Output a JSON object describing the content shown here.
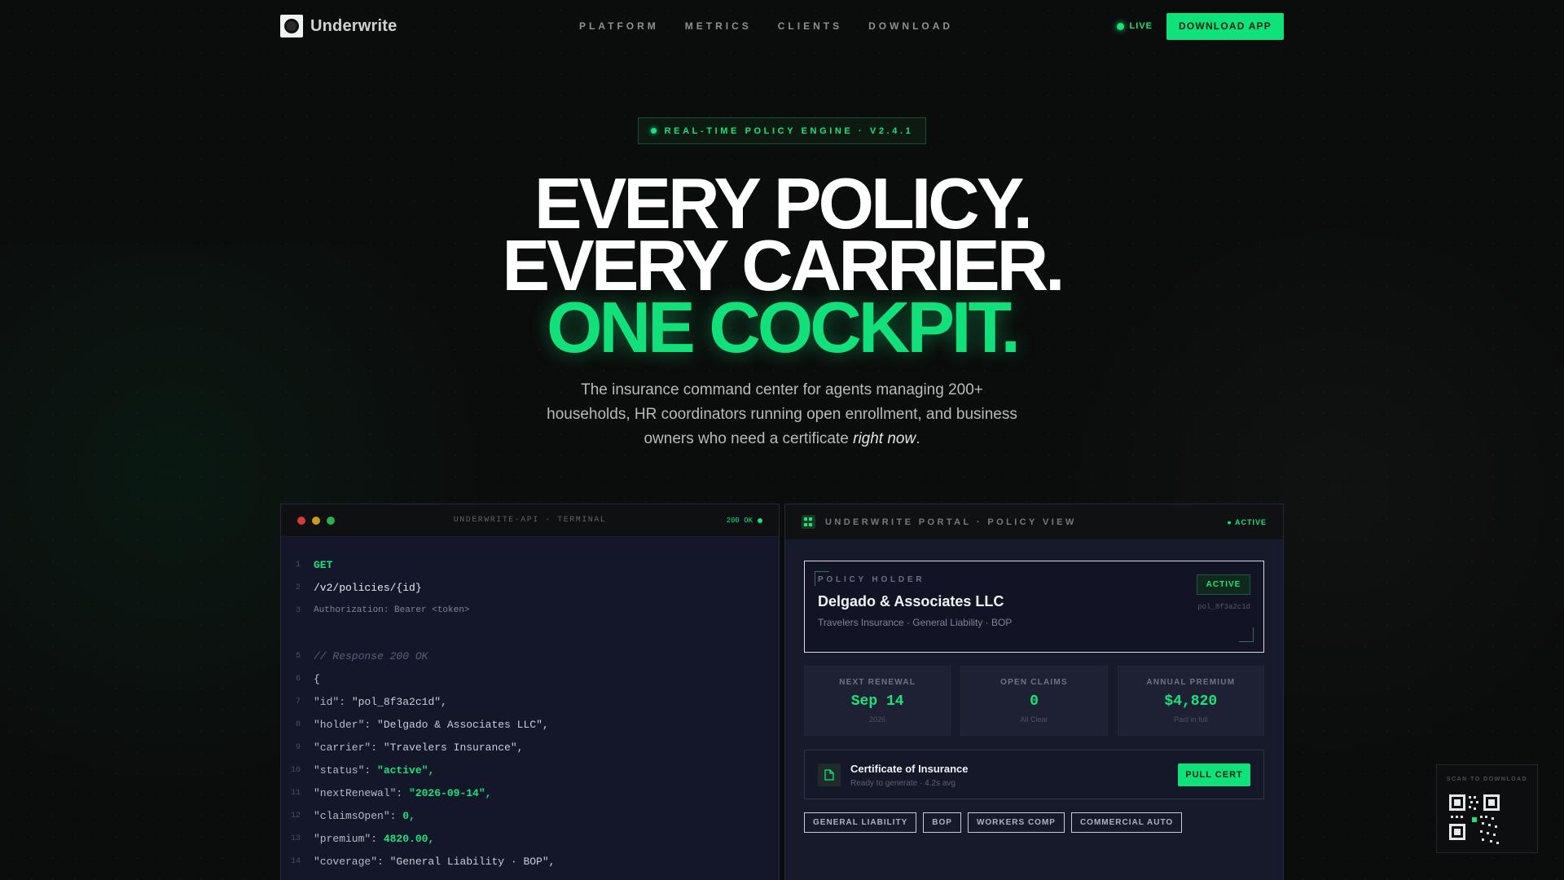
{
  "brand": {
    "name": "Underwrite"
  },
  "nav": {
    "links": [
      "PLATFORM",
      "METRICS",
      "CLIENTS",
      "DOWNLOAD"
    ],
    "live_label": "LIVE",
    "download_label": "DOWNLOAD APP"
  },
  "hero": {
    "badge": "REAL-TIME POLICY ENGINE · V2.4.1",
    "line1": "EVERY POLICY.",
    "line2": "EVERY CARRIER.",
    "line3": "ONE COCKPIT.",
    "subtitle_lead": "The insurance command center for agents managing 200+ households, HR coordinators running open enrollment, and business owners who need a certificate ",
    "subtitle_emphasis": "right now",
    "subtitle_end": "."
  },
  "terminal": {
    "title": "UNDERWRITE-API · TERMINAL",
    "status": "200 OK",
    "lines": [
      {
        "n": "1",
        "text": "GET",
        "style": "kw"
      },
      {
        "n": "2",
        "text": "/v2/policies/{id}",
        "style": "path"
      },
      {
        "n": "3",
        "text": "Authorization: Bearer <token>",
        "style": "small"
      },
      {
        "n": "",
        "text": "",
        "style": ""
      },
      {
        "n": "5",
        "text": "// Response 200 OK",
        "style": "comment"
      },
      {
        "n": "6",
        "text": "{",
        "style": ""
      },
      {
        "n": "7",
        "key": "\"id\"",
        "val": "\"pol_8f3a2c1d\",",
        "vstyle": "s"
      },
      {
        "n": "8",
        "key": "\"holder\"",
        "val": "\"Delgado & Associates LLC\",",
        "vstyle": "s"
      },
      {
        "n": "9",
        "key": "\"carrier\"",
        "val": "\"Travelers Insurance\",",
        "vstyle": "s"
      },
      {
        "n": "10",
        "key": "\"status\"",
        "val": "\"active\",",
        "vstyle": "g"
      },
      {
        "n": "11",
        "key": "\"nextRenewal\"",
        "val": "\"2026-09-14\",",
        "vstyle": "g"
      },
      {
        "n": "12",
        "key": "\"claimsOpen\"",
        "val": "0,",
        "vstyle": "g"
      },
      {
        "n": "13",
        "key": "\"premium\"",
        "val": "4820.00,",
        "vstyle": "g"
      },
      {
        "n": "14",
        "key": "\"coverage\"",
        "val": "\"General Liability · BOP\",",
        "vstyle": "s"
      }
    ]
  },
  "portal": {
    "title": "UNDERWRITE PORTAL · POLICY VIEW",
    "active_label": "● ACTIVE",
    "holder": {
      "label": "POLICY HOLDER",
      "name": "Delgado & Associates LLC",
      "meta": "Travelers Insurance · General Liability · BOP",
      "badge": "ACTIVE",
      "id": "pol_8f3a2c1d"
    },
    "stats": [
      {
        "label": "NEXT RENEWAL",
        "value": "Sep 14",
        "sub": "2026"
      },
      {
        "label": "OPEN CLAIMS",
        "value": "0",
        "sub": "All Clear"
      },
      {
        "label": "ANNUAL PREMIUM",
        "value": "$4,820",
        "sub": "Paid in full"
      }
    ],
    "cert": {
      "title": "Certificate of Insurance",
      "sub": "Ready to generate · 4.2s avg",
      "button": "PULL CERT"
    },
    "tags": [
      "GENERAL LIABILITY",
      "BOP",
      "WORKERS COMP",
      "COMMERCIAL AUTO"
    ]
  },
  "qr": {
    "label": "SCAN TO DOWNLOAD"
  },
  "colors": {
    "accent": "#12e07a",
    "background": "#0b0c0c",
    "panel": "#14172a"
  }
}
